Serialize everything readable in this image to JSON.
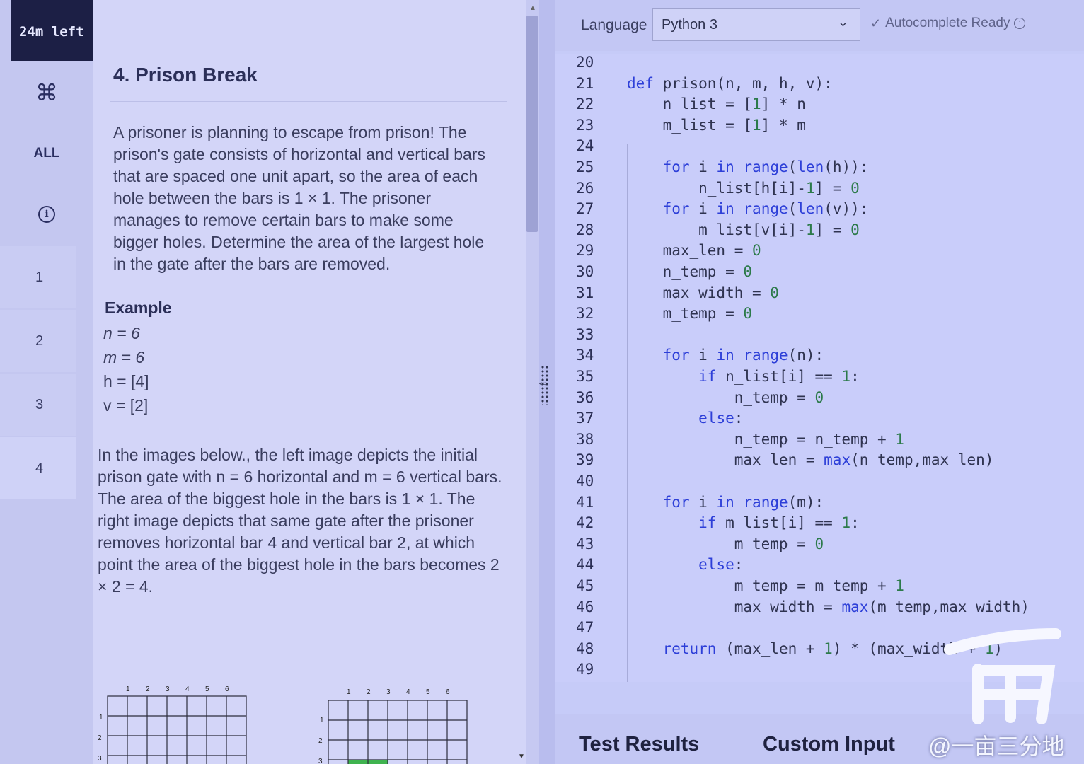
{
  "timer": "24m left",
  "rail": {
    "cmd_symbol": "⌘",
    "all_label": "ALL",
    "questions": [
      "1",
      "2",
      "3",
      "4"
    ]
  },
  "problem": {
    "title": "4. Prison Break",
    "paragraph1": "A prisoner is planning to escape from prison! The prison's gate consists of horizontal and vertical bars that are spaced one unit apart, so the area of each hole between the bars is 1 × 1. The prisoner manages to remove certain bars to make some bigger holes. Determine the area of the largest hole in the gate after the bars are removed.",
    "example_title": "Example",
    "example_lines": [
      "n = 6",
      "m = 6",
      "h = [4]",
      "v = [2]"
    ],
    "paragraph2": "In the images below., the left image depicts the initial prison gate with n = 6 horizontal and m = 6 vertical bars. The area of the biggest hole in the bars is 1 × 1. The right image depicts that same gate after the prisoner removes horizontal bar 4 and vertical bar 2, at which point the area of the biggest hole in the bars becomes 2 × 2 = 4.",
    "figure_col_labels": [
      "1",
      "2",
      "3",
      "4",
      "5",
      "6"
    ],
    "figure_row_labels": [
      "1",
      "2",
      "3"
    ]
  },
  "editor": {
    "language_label": "Language",
    "language_value": "Python 3",
    "autocomplete_status": "Autocomplete Ready",
    "code_lines": [
      {
        "n": "20",
        "code": ""
      },
      {
        "n": "21",
        "code": "def prison(n, m, h, v):"
      },
      {
        "n": "22",
        "code": "    n_list = [1] * n"
      },
      {
        "n": "23",
        "code": "    m_list = [1] * m"
      },
      {
        "n": "24",
        "code": ""
      },
      {
        "n": "25",
        "code": "    for i in range(len(h)):"
      },
      {
        "n": "26",
        "code": "        n_list[h[i]-1] = 0"
      },
      {
        "n": "27",
        "code": "    for i in range(len(v)):"
      },
      {
        "n": "28",
        "code": "        m_list[v[i]-1] = 0"
      },
      {
        "n": "29",
        "code": "    max_len = 0"
      },
      {
        "n": "30",
        "code": "    n_temp = 0"
      },
      {
        "n": "31",
        "code": "    max_width = 0"
      },
      {
        "n": "32",
        "code": "    m_temp = 0"
      },
      {
        "n": "33",
        "code": ""
      },
      {
        "n": "34",
        "code": "    for i in range(n):"
      },
      {
        "n": "35",
        "code": "        if n_list[i] == 1:"
      },
      {
        "n": "36",
        "code": "            n_temp = 0"
      },
      {
        "n": "37",
        "code": "        else:"
      },
      {
        "n": "38",
        "code": "            n_temp = n_temp + 1"
      },
      {
        "n": "39",
        "code": "            max_len = max(n_temp,max_len)"
      },
      {
        "n": "40",
        "code": ""
      },
      {
        "n": "41",
        "code": "    for i in range(m):"
      },
      {
        "n": "42",
        "code": "        if m_list[i] == 1:"
      },
      {
        "n": "43",
        "code": "            m_temp = 0"
      },
      {
        "n": "44",
        "code": "        else:"
      },
      {
        "n": "45",
        "code": "            m_temp = m_temp + 1"
      },
      {
        "n": "46",
        "code": "            max_width = max(m_temp,max_width)"
      },
      {
        "n": "47",
        "code": ""
      },
      {
        "n": "48",
        "code": "    return (max_len + 1) * (max_width + 1)"
      },
      {
        "n": "49",
        "code": ""
      }
    ]
  },
  "bottom_tabs": {
    "test_results": "Test Results",
    "custom_input": "Custom Input"
  },
  "watermark": "@一亩三分地"
}
